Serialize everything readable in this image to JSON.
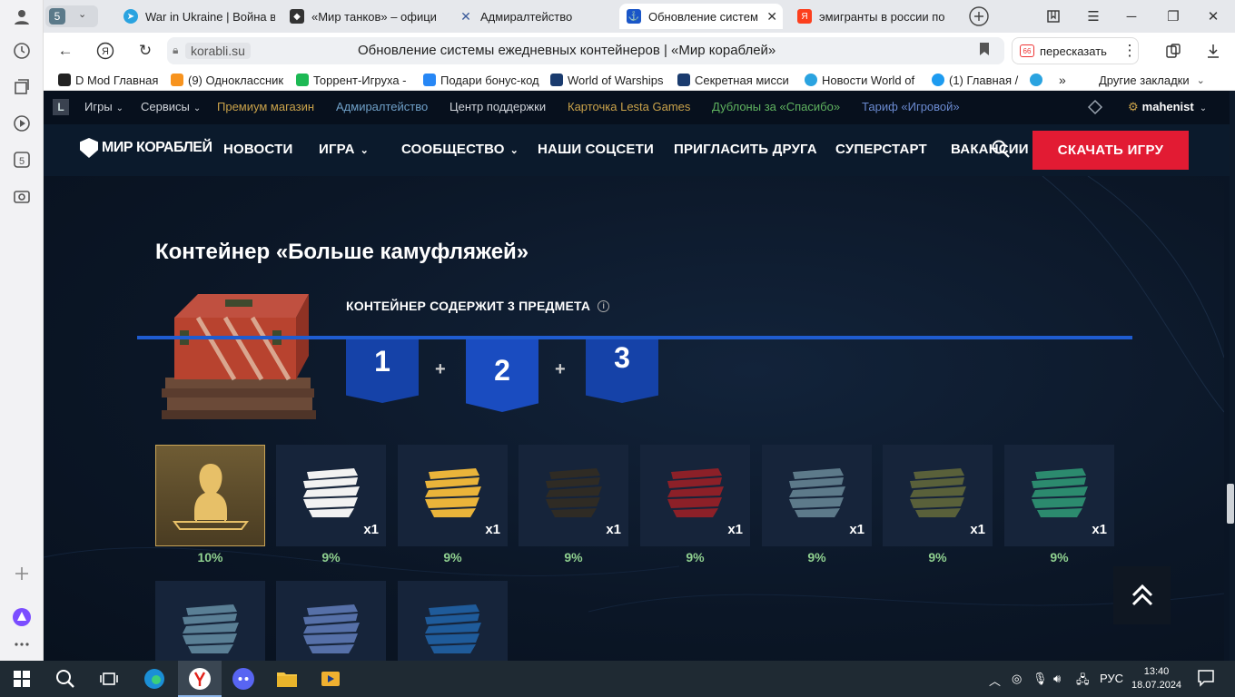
{
  "browser": {
    "profile_badge": "5",
    "tabs": [
      {
        "title": "War in Ukraine | Война в",
        "favicon": "telegram-icon",
        "active": false
      },
      {
        "title": "«Мир танков» – офици",
        "favicon": "tank-icon",
        "active": false
      },
      {
        "title": "Адмиралтейство",
        "favicon": "admiralty-icon",
        "active": false
      },
      {
        "title": "Обновление систем",
        "favicon": "korabli-icon",
        "active": true
      },
      {
        "title": "эмигранты в россии по",
        "favicon": "yandex-icon",
        "active": false
      }
    ],
    "url_domain": "korabli.su",
    "page_title": "Обновление системы ежедневных контейнеров | «Мир кораблей»",
    "retell_label": "пересказать",
    "bookmarks": [
      {
        "label": "D Mod Главная",
        "color": "#222"
      },
      {
        "label": "(9) Одноклассник",
        "color": "#f7931e"
      },
      {
        "label": "Торрент-Игруха -",
        "color": "#1db954"
      },
      {
        "label": "Подари бонус-код",
        "color": "#2787f5"
      },
      {
        "label": "World of Warships",
        "color": "#1a3b6e"
      },
      {
        "label": "Секретная мисси",
        "color": "#1a3b6e"
      },
      {
        "label": "Новости World of",
        "color": "#2aa3e0"
      },
      {
        "label": "(1) Главная /",
        "color": "#1d9bf0"
      }
    ],
    "other_bookmarks": "Другие закладки"
  },
  "site": {
    "util_nav": [
      {
        "label": "Игры",
        "color": "#d0d4da",
        "dropdown": true
      },
      {
        "label": "Сервисы",
        "color": "#d0d4da",
        "dropdown": true
      },
      {
        "label": "Премиум магазин",
        "color": "#c9a24a",
        "dropdown": false
      },
      {
        "label": "Адмиралтейство",
        "color": "#6fa0c8",
        "dropdown": false
      },
      {
        "label": "Центр поддержки",
        "color": "#d0d4da",
        "dropdown": false
      },
      {
        "label": "Карточка Lesta Games",
        "color": "#c9a24a",
        "dropdown": false
      },
      {
        "label": "Дублоны за «Спасибо»",
        "color": "#5fb35f",
        "dropdown": false
      },
      {
        "label": "Тариф «Игровой»",
        "color": "#6a8ad0",
        "dropdown": false
      }
    ],
    "username": "mahenist",
    "logo_text": "МИР КОРАБЛЕЙ",
    "main_nav": [
      {
        "label": "НОВОСТИ",
        "dropdown": false
      },
      {
        "label": "ИГРА",
        "dropdown": true
      },
      {
        "label": "СООБЩЕСТВО",
        "dropdown": true
      },
      {
        "label": "НАШИ СОЦСЕТИ",
        "dropdown": false
      },
      {
        "label": "ПРИГЛАСИТЬ ДРУГА",
        "dropdown": false
      },
      {
        "label": "СУПЕРСТАРТ",
        "dropdown": false
      },
      {
        "label": "ВАКАНСИИ",
        "dropdown": false
      }
    ],
    "download_button": "СКАЧАТЬ ИГРУ"
  },
  "content": {
    "heading": "Контейнер «Больше камуфляжей»",
    "contains_label": "КОНТЕЙНЕР СОДЕРЖИТ 3 ПРЕДМЕТА",
    "slots": [
      "1",
      "2",
      "3"
    ],
    "plus": "+",
    "items": [
      {
        "kind": "commander",
        "qty": "",
        "pct": "10%",
        "color": "#e7c068"
      },
      {
        "kind": "camo",
        "qty": "x1",
        "pct": "9%",
        "color": "#f2f2f2"
      },
      {
        "kind": "camo",
        "qty": "x1",
        "pct": "9%",
        "color": "#eab43a"
      },
      {
        "kind": "camo",
        "qty": "x1",
        "pct": "9%",
        "color": "#2f2b24"
      },
      {
        "kind": "camo",
        "qty": "x1",
        "pct": "9%",
        "color": "#8c2028"
      },
      {
        "kind": "camo",
        "qty": "x1",
        "pct": "9%",
        "color": "#5d7a8a"
      },
      {
        "kind": "camo",
        "qty": "x1",
        "pct": "9%",
        "color": "#59603a"
      },
      {
        "kind": "camo",
        "qty": "x1",
        "pct": "9%",
        "color": "#2c8a6e"
      },
      {
        "kind": "camo",
        "qty": "",
        "pct": "",
        "color": "#5a7f95"
      },
      {
        "kind": "camo",
        "qty": "",
        "pct": "",
        "color": "#5670a8"
      },
      {
        "kind": "camo",
        "qty": "",
        "pct": "",
        "color": "#1f5b9a"
      }
    ]
  },
  "taskbar": {
    "language": "РУС",
    "time": "13:40",
    "date": "18.07.2024"
  }
}
